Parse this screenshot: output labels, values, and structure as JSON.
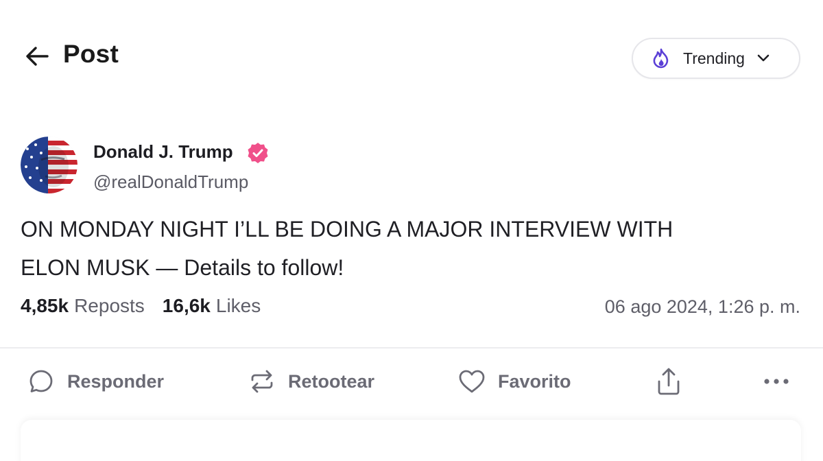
{
  "header": {
    "title": "Post",
    "back_icon": "arrow-left-icon",
    "trending": {
      "label": "Trending",
      "icon": "flame-icon",
      "chevron": "chevron-down-icon"
    }
  },
  "author": {
    "name": "Donald J. Trump",
    "handle": "@realDonaldTrump",
    "verified": true,
    "verified_color": "#f0508a",
    "avatar": "avatar-flag-portrait"
  },
  "post": {
    "lines": [
      "ON MONDAY NIGHT I’LL BE DOING A MAJOR INTERVIEW WITH",
      "ELON MUSK — Details to follow!"
    ]
  },
  "stats": {
    "reposts_count": "4,85k",
    "reposts_label": "Reposts",
    "likes_count": "16,6k",
    "likes_label": "Likes",
    "timestamp": "06 ago 2024, 1:26 p. m."
  },
  "actions": {
    "reply": "Responder",
    "retoot": "Retootear",
    "favorite": "Favorito"
  },
  "colors": {
    "accent": "#5b3fd6",
    "muted_text": "#6b6b75",
    "verified": "#f0508a"
  }
}
